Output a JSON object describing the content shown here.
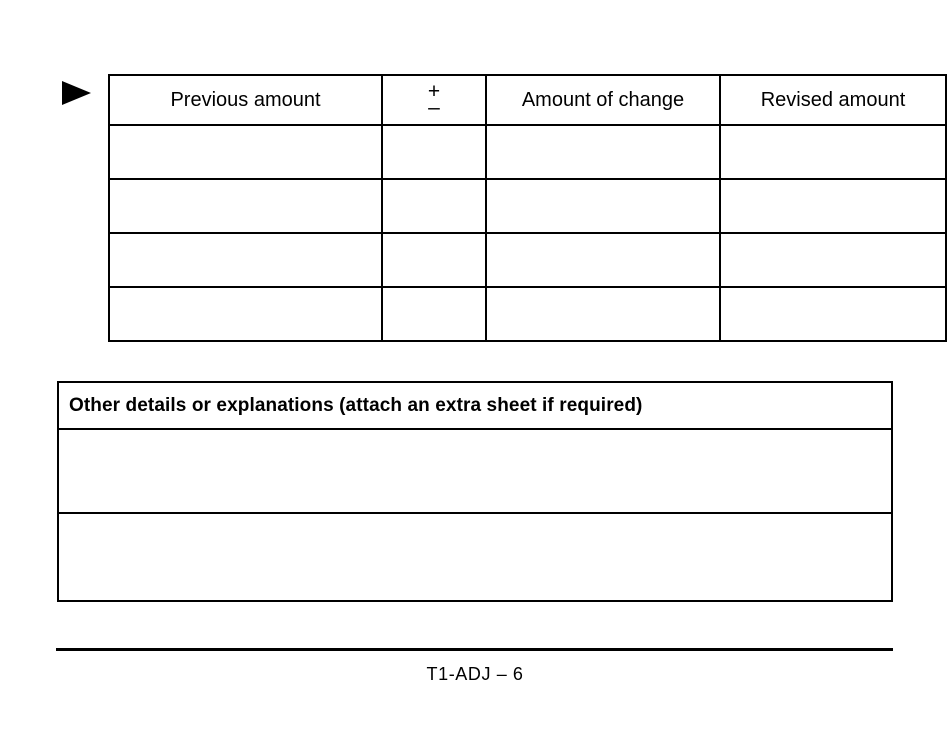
{
  "page": {
    "background_color": "#ffffff",
    "ink_color": "#000000"
  },
  "marker": {
    "icon": "right-triangle-marker"
  },
  "amounts_table": {
    "columns": [
      {
        "key": "previous",
        "label": "Previous amount"
      },
      {
        "key": "sign",
        "label": "+/-",
        "plus": "+",
        "minus": "–"
      },
      {
        "key": "change",
        "label": "Amount of change"
      },
      {
        "key": "revised",
        "label": "Revised amount"
      }
    ],
    "rows": [
      {
        "previous": "",
        "sign": "",
        "change": "",
        "revised": ""
      },
      {
        "previous": "",
        "sign": "",
        "change": "",
        "revised": ""
      },
      {
        "previous": "",
        "sign": "",
        "change": "",
        "revised": ""
      },
      {
        "previous": "",
        "sign": "",
        "change": "",
        "revised": ""
      }
    ]
  },
  "details_box": {
    "header": "Other details or explanations (attach an extra sheet if required)",
    "lines": [
      "",
      ""
    ]
  },
  "footer": {
    "label": "T1-ADJ – 6"
  }
}
